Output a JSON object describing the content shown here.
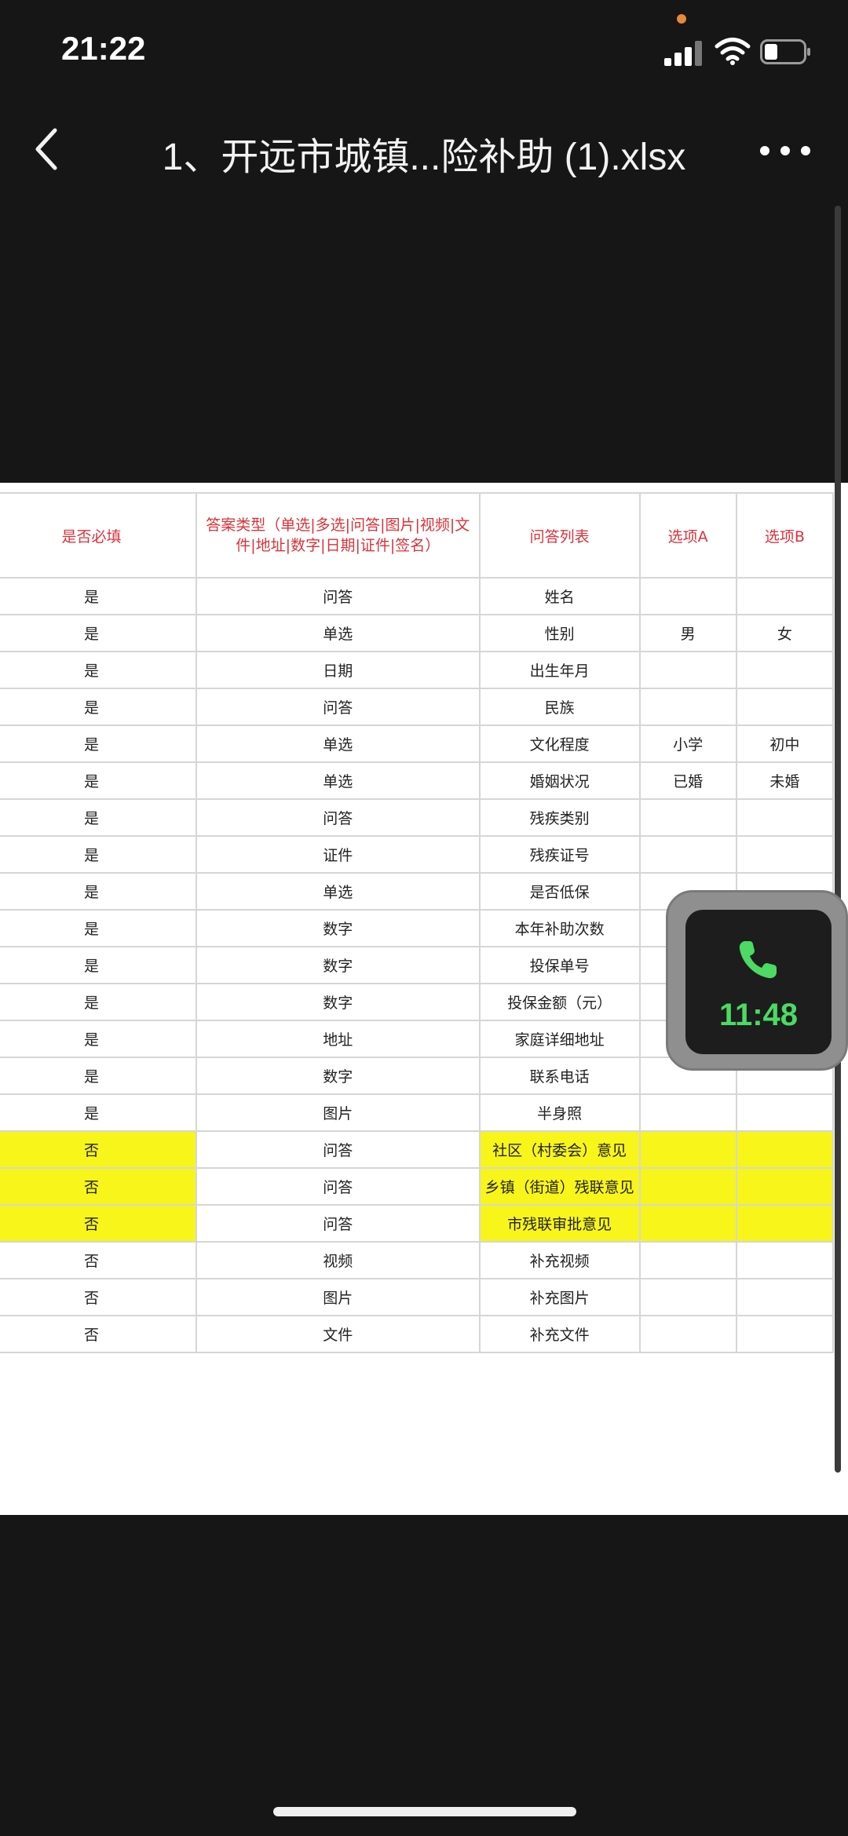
{
  "status_bar": {
    "time": "21:22"
  },
  "nav": {
    "title": "1、开远市城镇...险补助 (1).xlsx"
  },
  "table": {
    "headers": [
      "是否必填",
      "答案类型（单选|多选|问答|图片|视频|文件|地址|数字|日期|证件|签名）",
      "问答列表",
      "选项A",
      "选项B"
    ],
    "rows": [
      [
        "是",
        "问答",
        "姓名",
        "",
        ""
      ],
      [
        "是",
        "单选",
        "性别",
        "男",
        "女"
      ],
      [
        "是",
        "日期",
        "出生年月",
        "",
        ""
      ],
      [
        "是",
        "问答",
        "民族",
        "",
        ""
      ],
      [
        "是",
        "单选",
        "文化程度",
        "小学",
        "初中"
      ],
      [
        "是",
        "单选",
        "婚姻状况",
        "已婚",
        "未婚"
      ],
      [
        "是",
        "问答",
        "残疾类别",
        "",
        ""
      ],
      [
        "是",
        "证件",
        "残疾证号",
        "",
        ""
      ],
      [
        "是",
        "单选",
        "是否低保",
        "",
        ""
      ],
      [
        "是",
        "数字",
        "本年补助次数",
        "",
        ""
      ],
      [
        "是",
        "数字",
        "投保单号",
        "",
        ""
      ],
      [
        "是",
        "数字",
        "投保金额（元）",
        "",
        ""
      ],
      [
        "是",
        "地址",
        "家庭详细地址",
        "",
        ""
      ],
      [
        "是",
        "数字",
        "联系电话",
        "",
        ""
      ],
      [
        "是",
        "图片",
        "半身照",
        "",
        ""
      ],
      [
        "否",
        "问答",
        "社区（村委会）意见",
        "",
        ""
      ],
      [
        "否",
        "问答",
        "乡镇（街道）残联意见",
        "",
        ""
      ],
      [
        "否",
        "问答",
        "市残联审批意见",
        "",
        ""
      ],
      [
        "否",
        "视频",
        "补充视频",
        "",
        ""
      ],
      [
        "否",
        "图片",
        "补充图片",
        "",
        ""
      ],
      [
        "否",
        "文件",
        "补充文件",
        "",
        ""
      ]
    ]
  },
  "call_widget": {
    "time": "11:48"
  },
  "colors": {
    "header_text": "#d8333a",
    "highlight": "#f7f51a",
    "call_green": "#4cd964"
  },
  "icons": [
    "back-chevron-icon",
    "more-icon",
    "phone-icon",
    "signal-icon",
    "wifi-icon",
    "battery-icon"
  ]
}
